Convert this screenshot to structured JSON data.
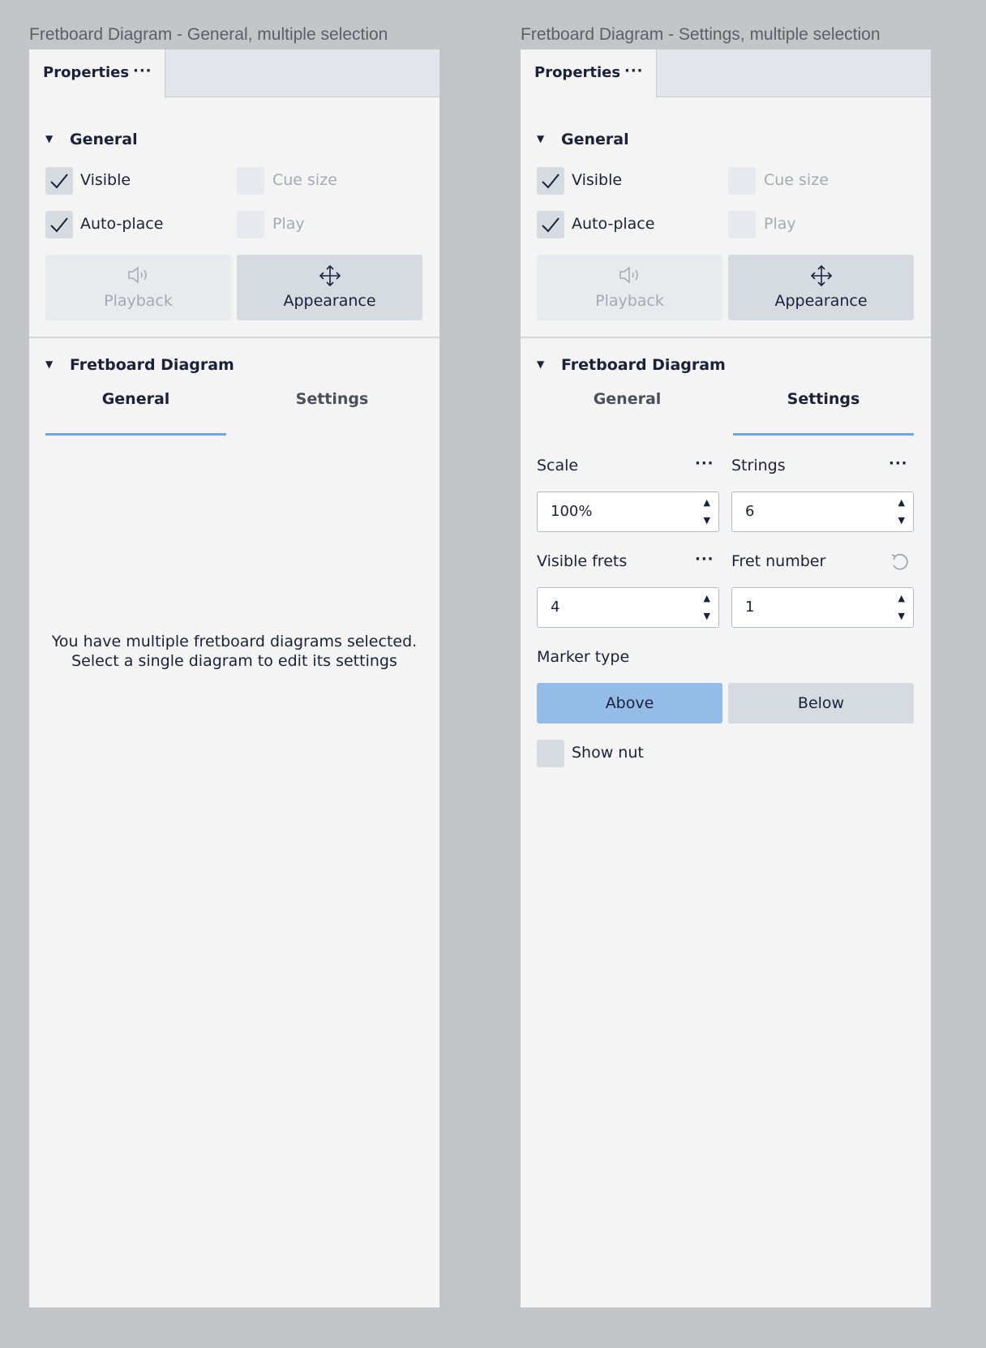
{
  "frames": [
    {
      "title": "Fretboard Diagram - General, multiple selection",
      "panel_tab": "Properties",
      "panel_tab_more": "···",
      "general": {
        "header": "General",
        "visible": "Visible",
        "auto_place": "Auto-place",
        "cue_size": "Cue size",
        "play": "Play",
        "playback": "Playback",
        "appearance": "Appearance"
      },
      "fretboard": {
        "header": "Fretboard Diagram",
        "tab_general": "General",
        "tab_settings": "Settings",
        "message_line1": "You have multiple fretboard diagrams selected.",
        "message_line2": "Select a single diagram to edit its settings"
      }
    },
    {
      "title": "Fretboard Diagram - Settings, multiple selection",
      "panel_tab": "Properties",
      "panel_tab_more": "···",
      "general": {
        "header": "General",
        "visible": "Visible",
        "auto_place": "Auto-place",
        "cue_size": "Cue size",
        "play": "Play",
        "playback": "Playback",
        "appearance": "Appearance"
      },
      "fretboard": {
        "header": "Fretboard Diagram",
        "tab_general": "General",
        "tab_settings": "Settings",
        "scale_label": "Scale",
        "scale_value": "100%",
        "strings_label": "Strings",
        "strings_value": "6",
        "visible_frets_label": "Visible frets",
        "visible_frets_value": "4",
        "fret_number_label": "Fret number",
        "fret_number_value": "1",
        "more": "···",
        "marker_type_label": "Marker type",
        "marker_above": "Above",
        "marker_below": "Below",
        "show_nut": "Show nut"
      }
    }
  ],
  "colors": {
    "background": "#c4c5c8",
    "panel": "#f4f4f4",
    "accent": "#6ea6e6",
    "segment_active": "#93bde8"
  }
}
